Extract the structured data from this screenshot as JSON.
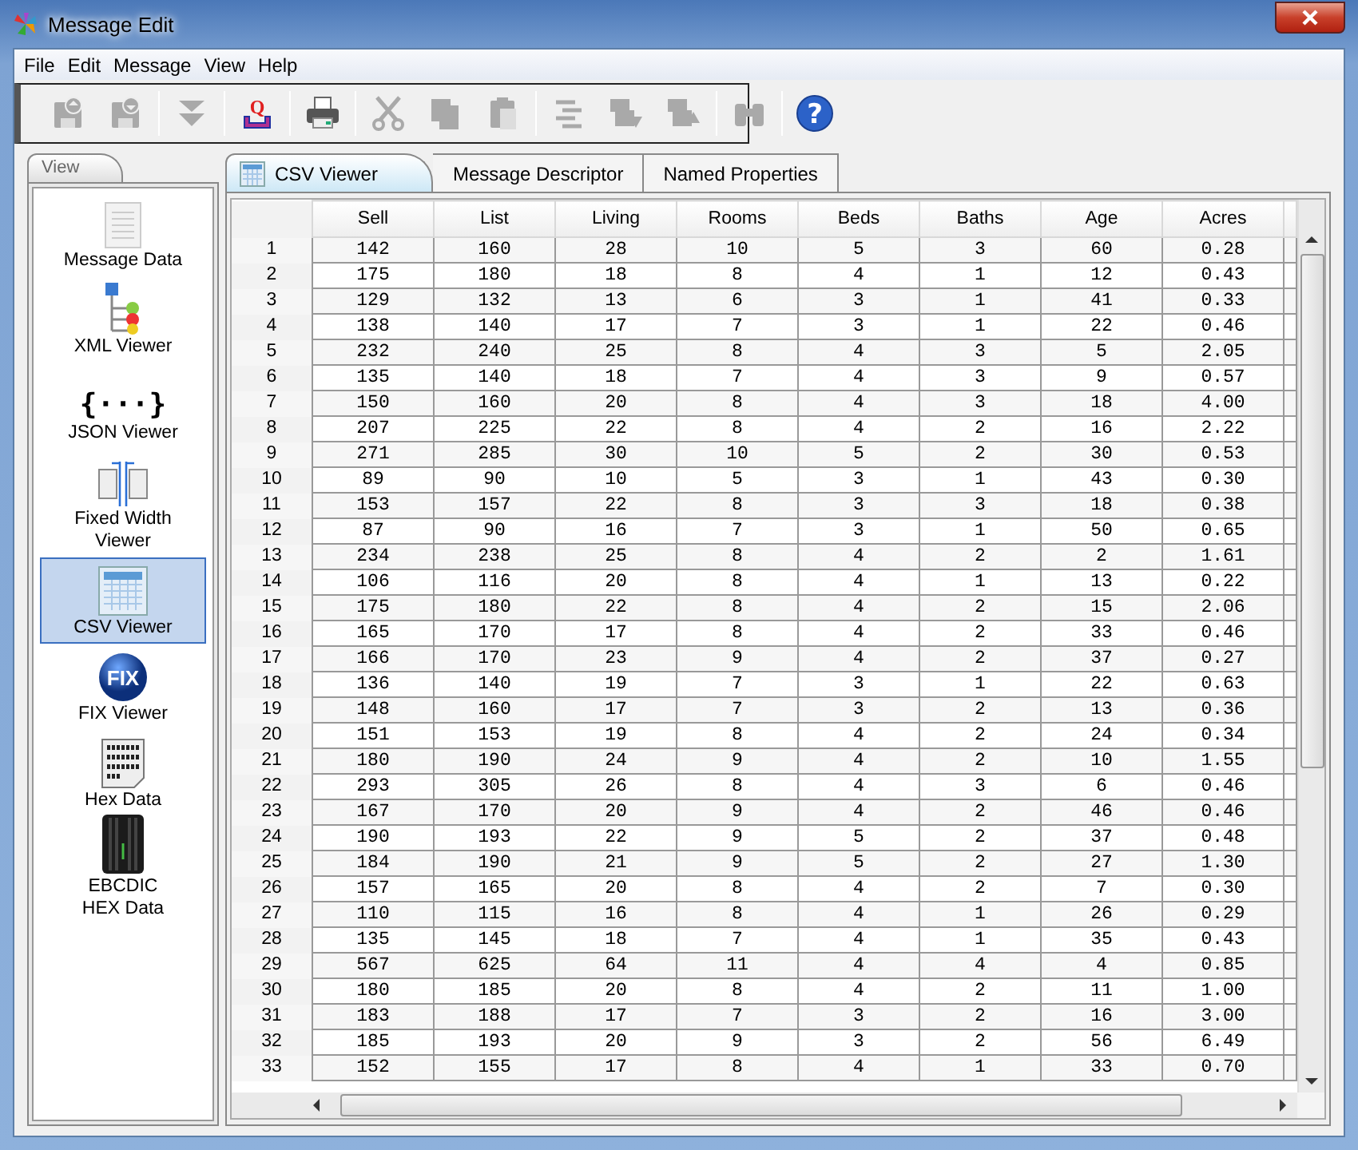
{
  "window": {
    "title": "Message Edit"
  },
  "menu": [
    "File",
    "Edit",
    "Message",
    "View",
    "Help"
  ],
  "toolbar_groups": [
    [
      {
        "kind": "save-up",
        "disabled": true
      },
      {
        "kind": "save-down",
        "disabled": true
      }
    ],
    [
      {
        "kind": "double-down",
        "disabled": true
      }
    ],
    [
      {
        "kind": "queue",
        "glyph": "Q",
        "disabled": false
      }
    ],
    [
      {
        "kind": "print",
        "disabled": false
      }
    ],
    [
      {
        "kind": "cut",
        "disabled": true
      },
      {
        "kind": "copy",
        "disabled": true
      },
      {
        "kind": "paste",
        "disabled": true
      }
    ],
    [
      {
        "kind": "align",
        "disabled": true
      },
      {
        "kind": "add-down",
        "disabled": true
      },
      {
        "kind": "remove-up",
        "disabled": true
      }
    ],
    [
      {
        "kind": "find",
        "disabled": true
      }
    ],
    [
      {
        "kind": "help",
        "glyph": "?",
        "disabled": false
      }
    ]
  ],
  "sidebar": {
    "tab": "View",
    "items": [
      {
        "label": "Message Data",
        "kind": "document",
        "selected": false
      },
      {
        "label": "XML Viewer",
        "kind": "tree",
        "selected": false
      },
      {
        "label": "JSON Viewer",
        "kind": "braces",
        "glyph": "{···}",
        "selected": false
      },
      {
        "label": "Fixed Width\nViewer",
        "kind": "columns",
        "selected": false
      },
      {
        "label": "CSV Viewer",
        "kind": "grid",
        "selected": true
      },
      {
        "label": "FIX Viewer",
        "kind": "globe",
        "glyph": "FIX",
        "selected": false
      },
      {
        "label": "Hex Data",
        "kind": "hex",
        "selected": false
      },
      {
        "label": "EBCDIC\nHEX Data",
        "kind": "server",
        "selected": false
      }
    ]
  },
  "tabs": [
    {
      "label": "CSV Viewer",
      "selected": true,
      "icon": true
    },
    {
      "label": "Message Descriptor",
      "selected": false
    },
    {
      "label": "Named Properties",
      "selected": false
    }
  ],
  "table": {
    "columns": [
      "Sell",
      "List",
      "Living",
      "Rooms",
      "Beds",
      "Baths",
      "Age",
      "Acres"
    ],
    "rows": [
      {
        "number": "1",
        "cells": [
          "142",
          "160",
          "28",
          "10",
          "5",
          "3",
          "60",
          "0.28"
        ]
      },
      {
        "number": "2",
        "cells": [
          "175",
          "180",
          "18",
          "8",
          "4",
          "1",
          "12",
          "0.43"
        ]
      },
      {
        "number": "3",
        "cells": [
          "129",
          "132",
          "13",
          "6",
          "3",
          "1",
          "41",
          "0.33"
        ]
      },
      {
        "number": "4",
        "cells": [
          "138",
          "140",
          "17",
          "7",
          "3",
          "1",
          "22",
          "0.46"
        ]
      },
      {
        "number": "5",
        "cells": [
          "232",
          "240",
          "25",
          "8",
          "4",
          "3",
          "5",
          "2.05"
        ]
      },
      {
        "number": "6",
        "cells": [
          "135",
          "140",
          "18",
          "7",
          "4",
          "3",
          "9",
          "0.57"
        ]
      },
      {
        "number": "7",
        "cells": [
          "150",
          "160",
          "20",
          "8",
          "4",
          "3",
          "18",
          "4.00"
        ]
      },
      {
        "number": "8",
        "cells": [
          "207",
          "225",
          "22",
          "8",
          "4",
          "2",
          "16",
          "2.22"
        ]
      },
      {
        "number": "9",
        "cells": [
          "271",
          "285",
          "30",
          "10",
          "5",
          "2",
          "30",
          "0.53"
        ]
      },
      {
        "number": "10",
        "cells": [
          "89",
          "90",
          "10",
          "5",
          "3",
          "1",
          "43",
          "0.30"
        ]
      },
      {
        "number": "11",
        "cells": [
          "153",
          "157",
          "22",
          "8",
          "3",
          "3",
          "18",
          "0.38"
        ]
      },
      {
        "number": "12",
        "cells": [
          "87",
          "90",
          "16",
          "7",
          "3",
          "1",
          "50",
          "0.65"
        ]
      },
      {
        "number": "13",
        "cells": [
          "234",
          "238",
          "25",
          "8",
          "4",
          "2",
          "2",
          "1.61"
        ]
      },
      {
        "number": "14",
        "cells": [
          "106",
          "116",
          "20",
          "8",
          "4",
          "1",
          "13",
          "0.22"
        ]
      },
      {
        "number": "15",
        "cells": [
          "175",
          "180",
          "22",
          "8",
          "4",
          "2",
          "15",
          "2.06"
        ]
      },
      {
        "number": "16",
        "cells": [
          "165",
          "170",
          "17",
          "8",
          "4",
          "2",
          "33",
          "0.46"
        ]
      },
      {
        "number": "17",
        "cells": [
          "166",
          "170",
          "23",
          "9",
          "4",
          "2",
          "37",
          "0.27"
        ]
      },
      {
        "number": "18",
        "cells": [
          "136",
          "140",
          "19",
          "7",
          "3",
          "1",
          "22",
          "0.63"
        ]
      },
      {
        "number": "19",
        "cells": [
          "148",
          "160",
          "17",
          "7",
          "3",
          "2",
          "13",
          "0.36"
        ]
      },
      {
        "number": "20",
        "cells": [
          "151",
          "153",
          "19",
          "8",
          "4",
          "2",
          "24",
          "0.34"
        ]
      },
      {
        "number": "21",
        "cells": [
          "180",
          "190",
          "24",
          "9",
          "4",
          "2",
          "10",
          "1.55"
        ]
      },
      {
        "number": "22",
        "cells": [
          "293",
          "305",
          "26",
          "8",
          "4",
          "3",
          "6",
          "0.46"
        ]
      },
      {
        "number": "23",
        "cells": [
          "167",
          "170",
          "20",
          "9",
          "4",
          "2",
          "46",
          "0.46"
        ]
      },
      {
        "number": "24",
        "cells": [
          "190",
          "193",
          "22",
          "9",
          "5",
          "2",
          "37",
          "0.48"
        ]
      },
      {
        "number": "25",
        "cells": [
          "184",
          "190",
          "21",
          "9",
          "5",
          "2",
          "27",
          "1.30"
        ]
      },
      {
        "number": "26",
        "cells": [
          "157",
          "165",
          "20",
          "8",
          "4",
          "2",
          "7",
          "0.30"
        ]
      },
      {
        "number": "27",
        "cells": [
          "110",
          "115",
          "16",
          "8",
          "4",
          "1",
          "26",
          "0.29"
        ]
      },
      {
        "number": "28",
        "cells": [
          "135",
          "145",
          "18",
          "7",
          "4",
          "1",
          "35",
          "0.43"
        ]
      },
      {
        "number": "29",
        "cells": [
          "567",
          "625",
          "64",
          "11",
          "4",
          "4",
          "4",
          "0.85"
        ]
      },
      {
        "number": "30",
        "cells": [
          "180",
          "185",
          "20",
          "8",
          "4",
          "2",
          "11",
          "1.00"
        ]
      },
      {
        "number": "31",
        "cells": [
          "183",
          "188",
          "17",
          "7",
          "3",
          "2",
          "16",
          "3.00"
        ]
      },
      {
        "number": "32",
        "cells": [
          "185",
          "193",
          "20",
          "9",
          "3",
          "2",
          "56",
          "6.49"
        ]
      },
      {
        "number": "33",
        "cells": [
          "152",
          "155",
          "17",
          "8",
          "4",
          "1",
          "33",
          "0.70"
        ]
      }
    ]
  }
}
